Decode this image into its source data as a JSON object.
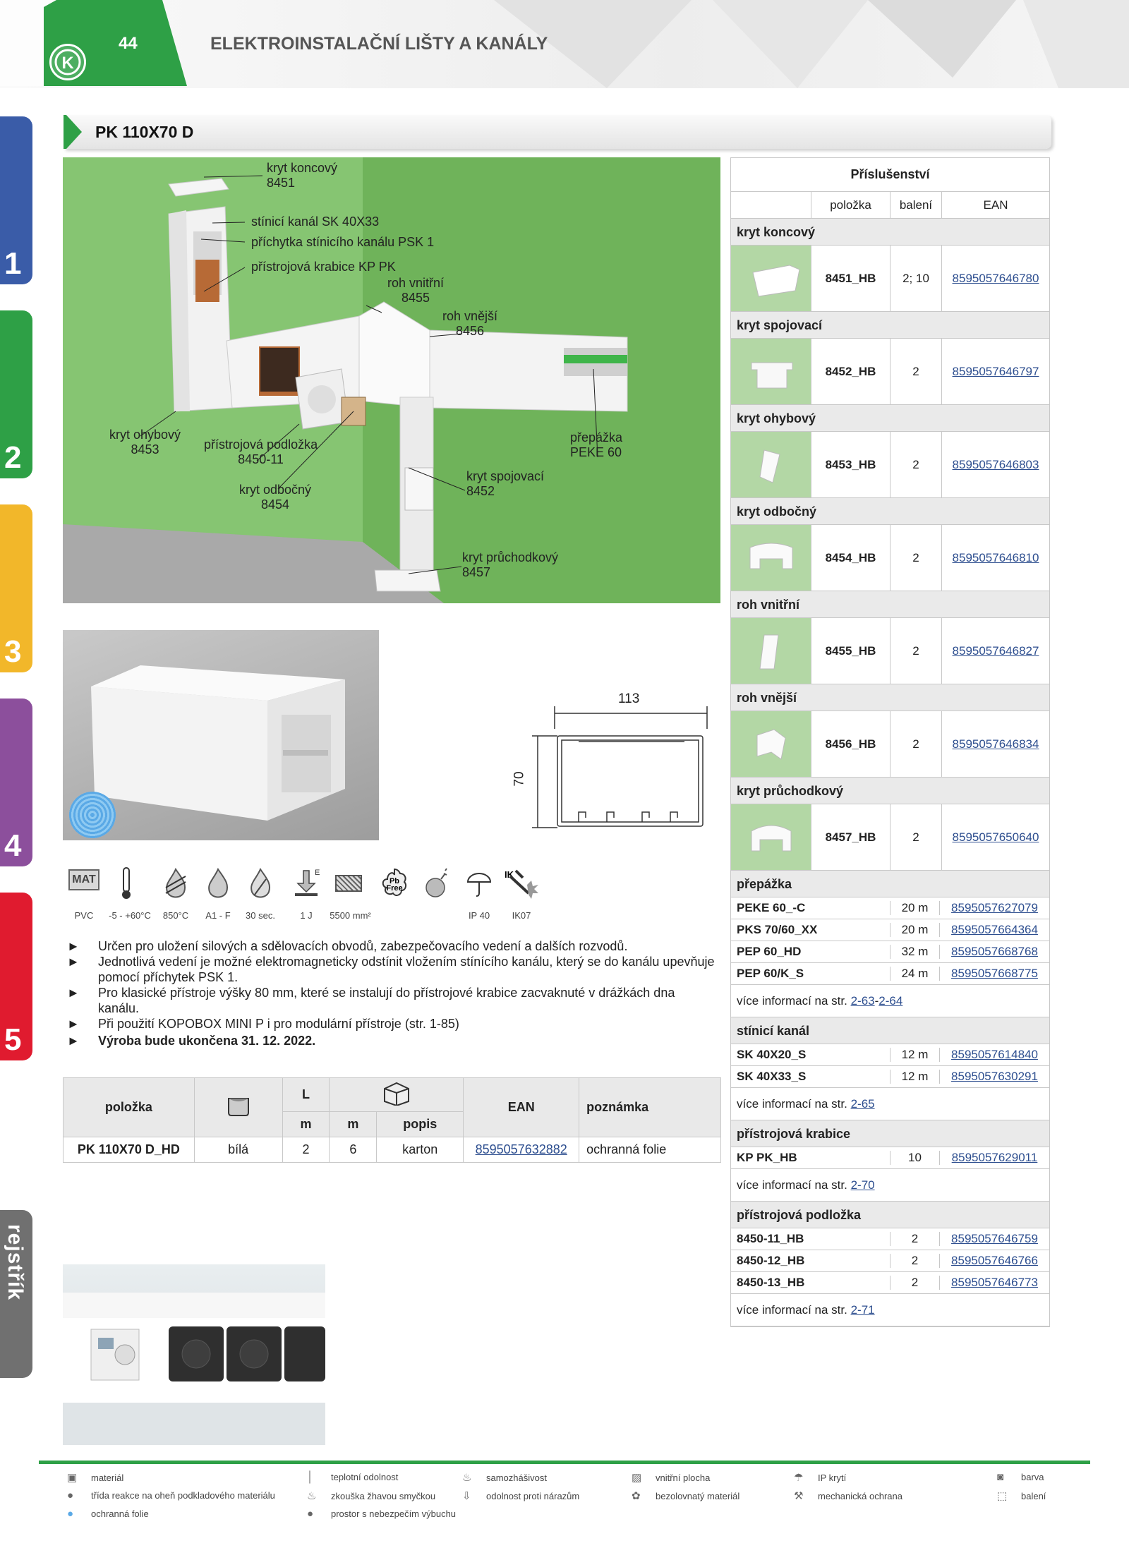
{
  "header": {
    "page_number": "44",
    "title": "ELEKTROINSTALAČNÍ LIŠTY A KANÁLY"
  },
  "side_tabs": [
    {
      "label": "1",
      "color": "#3a5ca8"
    },
    {
      "label": "2",
      "color": "#2ea046"
    },
    {
      "label": "3",
      "color": "#f2b72a"
    },
    {
      "label": "4",
      "color": "#8c4f9c"
    },
    {
      "label": "5",
      "color": "#e01b2f"
    },
    {
      "label": "rejstřík",
      "color": "#707070"
    }
  ],
  "product_title": "PK 110X70 D",
  "scene_labels": [
    {
      "text": "kryt koncový\n8451"
    },
    {
      "text": "stínicí kanál SK 40X33"
    },
    {
      "text": "příchytka stínicího kanálu PSK 1"
    },
    {
      "text": "přístrojová krabice KP PK"
    },
    {
      "text": "roh vnitřní\n8455"
    },
    {
      "text": "roh vnější\n8456"
    },
    {
      "text": "kryt ohybový\n8453"
    },
    {
      "text": "přístrojová podložka\n8450-11"
    },
    {
      "text": "kryt odbočný\n8454"
    },
    {
      "text": "přepážka\nPEKE 60"
    },
    {
      "text": "kryt spojovací\n8452"
    },
    {
      "text": "kryt průchodkový\n8457"
    }
  ],
  "dimensions": {
    "width": "113",
    "height": "70"
  },
  "properties": [
    {
      "icon": "mat-icon",
      "label": "PVC",
      "tag": "MAT"
    },
    {
      "icon": "thermometer-icon",
      "label": "-5 - +60°C"
    },
    {
      "icon": "glow-wire-icon",
      "label": "850°C"
    },
    {
      "icon": "flame-class-icon",
      "label": "A1 - F"
    },
    {
      "icon": "self-extinguish-icon",
      "label": "30 sec."
    },
    {
      "icon": "impact-icon",
      "label": "1 J",
      "tag": "E"
    },
    {
      "icon": "inner-area-icon",
      "label": "5500 mm²"
    },
    {
      "icon": "pb-free-icon",
      "label": "",
      "tag": "Pb\nFree"
    },
    {
      "icon": "explosion-icon",
      "label": ""
    },
    {
      "icon": "ip-rating-icon",
      "label": "IP 40"
    },
    {
      "icon": "ik-rating-icon",
      "label": "IK07",
      "tag": "IK"
    }
  ],
  "bullets": [
    {
      "marker": "►",
      "text": "Určen pro uložení silových a sdělovacích obvodů, zabezpečovacího vedení a dalších rozvodů."
    },
    {
      "marker": "►",
      "text": "Jednotlivá vedení je možné elektromagneticky odstínit vložením stínícího kanálu, který se do kanálu upevňuje pomocí příchytek PSK 1."
    },
    {
      "marker": "►",
      "text": "Pro klasické přístroje výšky 80 mm, které se instalují do přístrojové krabice zacvaknuté v drážkách dna kanálu."
    },
    {
      "marker": "►",
      "text": "Při použití KOPOBOX MINI P i pro modulární přístroje (str. 1-85)"
    },
    {
      "marker": "►",
      "text": "Výroba bude ukončena 31. 12. 2022."
    }
  ],
  "main_table": {
    "headers": {
      "item": "položka",
      "length": "L",
      "unit1": "m",
      "unit2": "m",
      "desc": "popis",
      "ean": "EAN",
      "note": "poznámka"
    },
    "row": {
      "item": "PK 110X70 D_HD",
      "color": "bílá",
      "length": "2",
      "pack": "6",
      "desc": "karton",
      "ean": "8595057632882",
      "note": "ochranná folie"
    }
  },
  "accessories": {
    "title": "Příslušenství",
    "headers": {
      "item": "položka",
      "pack": "balení",
      "ean": "EAN"
    },
    "image_items": [
      {
        "category": "kryt koncový",
        "code": "8451_HB",
        "pack": "2; 10",
        "ean": "8595057646780"
      },
      {
        "category": "kryt spojovací",
        "code": "8452_HB",
        "pack": "2",
        "ean": "8595057646797"
      },
      {
        "category": "kryt ohybový",
        "code": "8453_HB",
        "pack": "2",
        "ean": "8595057646803"
      },
      {
        "category": "kryt odbočný",
        "code": "8454_HB",
        "pack": "2",
        "ean": "8595057646810"
      },
      {
        "category": "roh vnitřní",
        "code": "8455_HB",
        "pack": "2",
        "ean": "8595057646827"
      },
      {
        "category": "roh vnější",
        "code": "8456_HB",
        "pack": "2",
        "ean": "8595057646834"
      },
      {
        "category": "kryt průchodkový",
        "code": "8457_HB",
        "pack": "2",
        "ean": "8595057650640"
      }
    ],
    "groups": [
      {
        "category": "přepážka",
        "rows": [
          {
            "code": "PEKE 60_-C",
            "pack": "20 m",
            "ean": "8595057627079"
          },
          {
            "code": "PKS 70/60_XX",
            "pack": "20 m",
            "ean": "8595057664364"
          },
          {
            "code": "PEP 60_HD",
            "pack": "32 m",
            "ean": "8595057668768"
          },
          {
            "code": "PEP 60/K_S",
            "pack": "24 m",
            "ean": "8595057668775"
          }
        ],
        "more_prefix": "více informací na str. ",
        "more_links": [
          "2-63",
          "2-64"
        ],
        "more_sep": " - "
      },
      {
        "category": "stínicí kanál",
        "rows": [
          {
            "code": "SK 40X20_S",
            "pack": "12 m",
            "ean": "8595057614840"
          },
          {
            "code": "SK 40X33_S",
            "pack": "12 m",
            "ean": "8595057630291"
          }
        ],
        "more_prefix": "více informací na str. ",
        "more_links": [
          "2-65"
        ],
        "more_sep": ""
      },
      {
        "category": "přístrojová krabice",
        "rows": [
          {
            "code": "KP PK_HB",
            "pack": "10",
            "ean": "8595057629011"
          }
        ],
        "more_prefix": "více informací na str. ",
        "more_links": [
          "2-70"
        ],
        "more_sep": ""
      },
      {
        "category": "přístrojová podložka",
        "rows": [
          {
            "code": "8450-11_HB",
            "pack": "2",
            "ean": "8595057646759"
          },
          {
            "code": "8450-12_HB",
            "pack": "2",
            "ean": "8595057646766"
          },
          {
            "code": "8450-13_HB",
            "pack": "2",
            "ean": "8595057646773"
          }
        ],
        "more_prefix": "více informací na str. ",
        "more_links": [
          "2-71"
        ],
        "more_sep": ""
      }
    ]
  },
  "legend": [
    {
      "icon": "mat-icon",
      "text": "materiál"
    },
    {
      "icon": "thermometer-icon",
      "text": "teplotní odolnost"
    },
    {
      "icon": "self-extinguish-icon",
      "text": "samozhášivost"
    },
    {
      "icon": "inner-area-icon",
      "text": "vnitřní plocha"
    },
    {
      "icon": "ip-rating-icon",
      "text": "IP krytí"
    },
    {
      "icon": "color-icon",
      "text": "barva"
    },
    {
      "icon": "flame-class-icon",
      "text": "třída reakce na oheň podkladového materiálu"
    },
    {
      "icon": "glow-wire-icon",
      "text": "zkouška žhavou smyčkou"
    },
    {
      "icon": "impact-icon",
      "text": "odolnost proti nárazům"
    },
    {
      "icon": "pb-free-icon",
      "text": "bezolovnatý materiál"
    },
    {
      "icon": "ik-rating-icon",
      "text": "mechanická ochrana"
    },
    {
      "icon": "package-icon",
      "text": "balení"
    },
    {
      "icon": "protective-foil-icon",
      "text": "ochranná folie"
    },
    {
      "icon": "explosion-icon",
      "text": "prostor s nebezpečím výbuchu"
    }
  ],
  "colors": {
    "green": "#2ea046",
    "link": "#2d4e8f",
    "scene_green": "#7fc06a",
    "thumb_green": "#b3d7a5"
  }
}
